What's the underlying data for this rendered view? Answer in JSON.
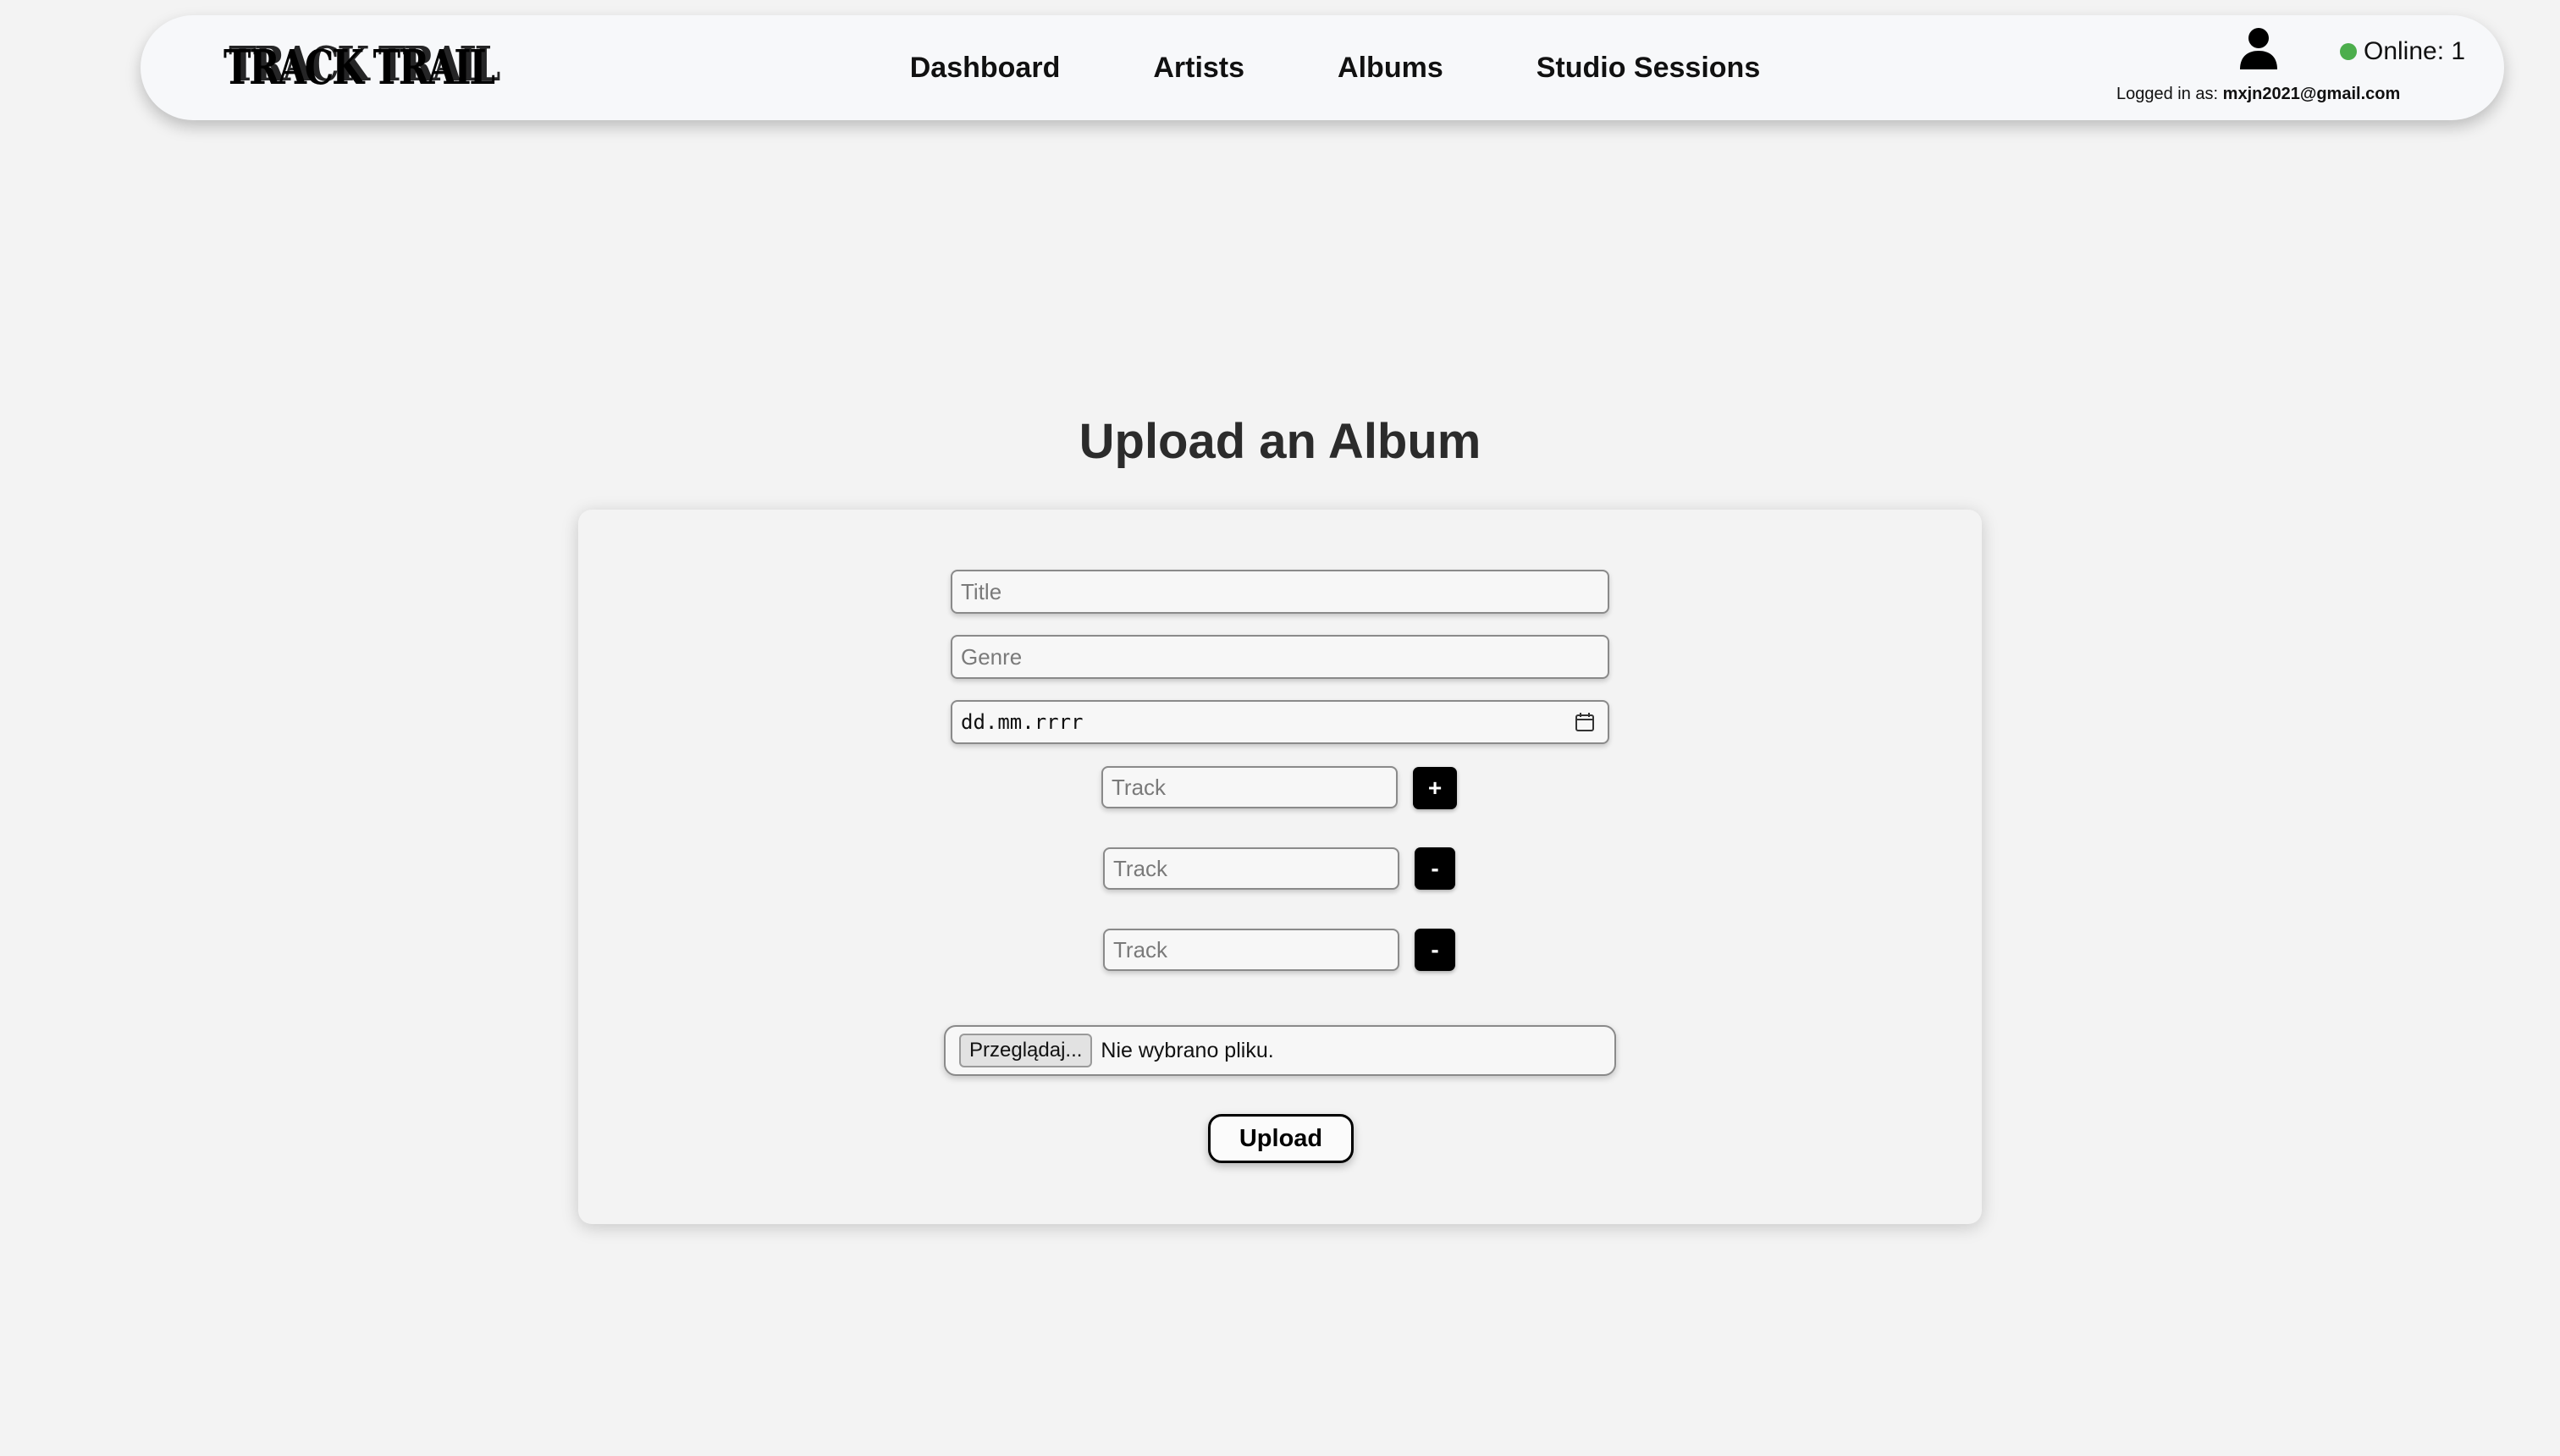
{
  "navbar": {
    "logo_text": "TRACK TRAIL",
    "links": [
      "Dashboard",
      "Artists",
      "Albums",
      "Studio Sessions"
    ],
    "online_label": "Online: 1",
    "logged_in_prefix": "Logged in as: ",
    "logged_in_email": "mxjn2021@gmail.com",
    "online_color": "#4cae4c"
  },
  "page": {
    "title": "Upload an Album"
  },
  "form": {
    "title_placeholder": "Title",
    "genre_placeholder": "Genre",
    "date_placeholder": "dd.mm.rrrr",
    "tracks": [
      {
        "placeholder": "Track",
        "button": "+"
      },
      {
        "placeholder": "Track",
        "button": "-"
      },
      {
        "placeholder": "Track",
        "button": "-"
      }
    ],
    "file_button": "Przeglądaj...",
    "file_status": "Nie wybrano pliku.",
    "upload_button": "Upload"
  },
  "icons": {
    "user": "user-icon",
    "calendar": "calendar-icon",
    "online_dot": "status-dot-icon"
  }
}
